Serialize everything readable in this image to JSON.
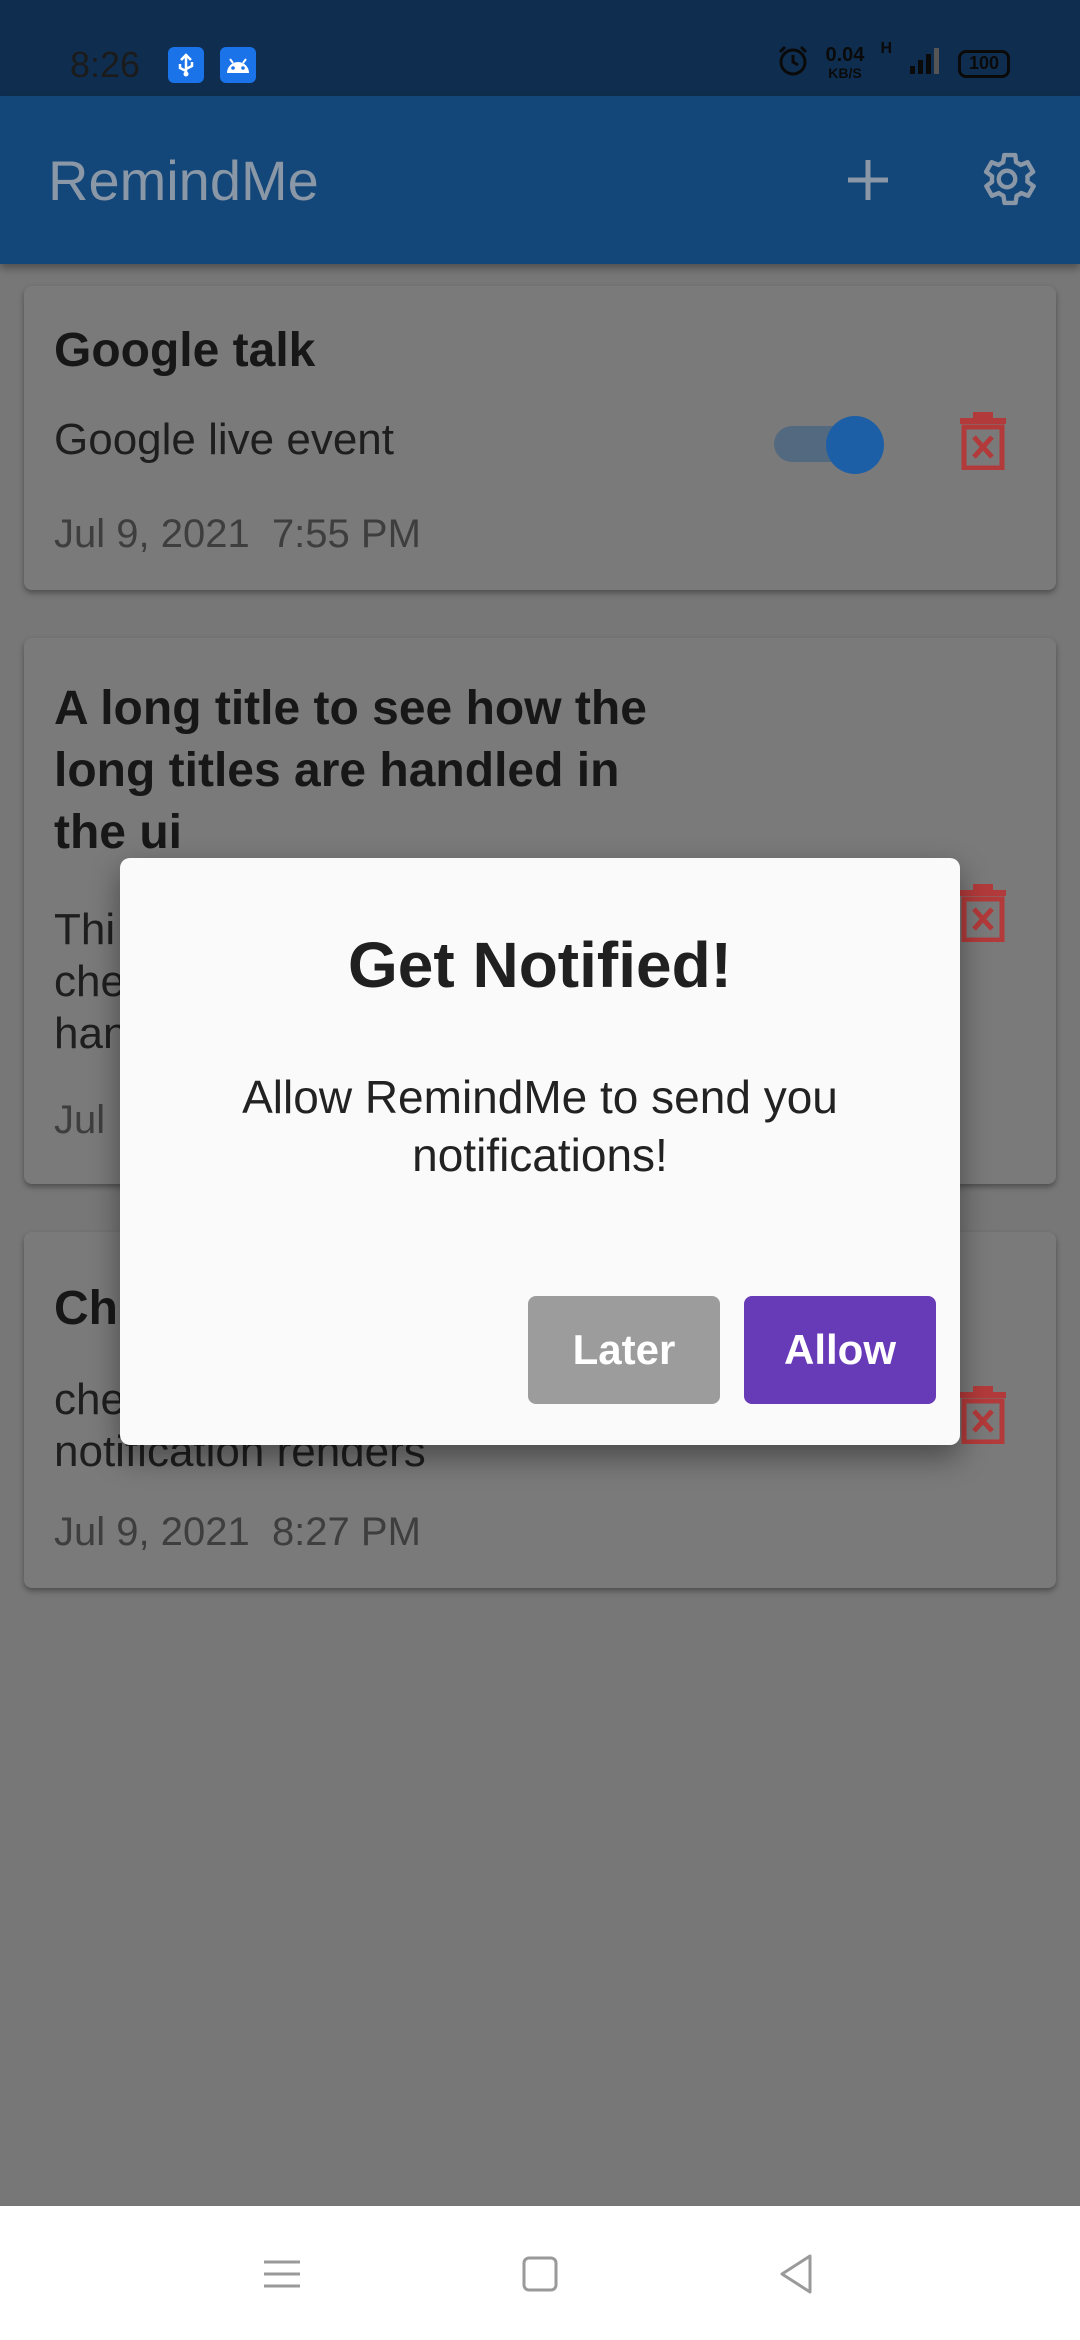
{
  "status_bar": {
    "time": "8:26",
    "speed_value": "0.04",
    "speed_unit": "KB/S",
    "network": "H",
    "battery": "100"
  },
  "app_bar": {
    "title": "RemindMe",
    "icons": [
      "add-icon",
      "gear-icon"
    ]
  },
  "reminders": [
    {
      "title": "Google talk",
      "description": "Google live event",
      "date": "Jul 9, 2021",
      "time": "7:55 PM",
      "enabled": true
    },
    {
      "title_lines": [
        "A long title to see how the",
        "long titles are handled in",
        "the ui"
      ],
      "description_lines": [
        "Thi",
        "che",
        "han"
      ],
      "date_partial": "Jul"
    },
    {
      "title_partial": "Ch",
      "description_lines": [
        "che",
        "notification renders"
      ],
      "date": "Jul 9, 2021",
      "time": "8:27 PM"
    }
  ],
  "dialog": {
    "title": "Get Notified!",
    "message": "Allow RemindMe to send you notifications!",
    "later_label": "Later",
    "allow_label": "Allow"
  },
  "colors": {
    "app_bar": "#134679",
    "accent": "#673ab7",
    "delete": "#b33a3a",
    "toggle": "#1c5fa6"
  }
}
